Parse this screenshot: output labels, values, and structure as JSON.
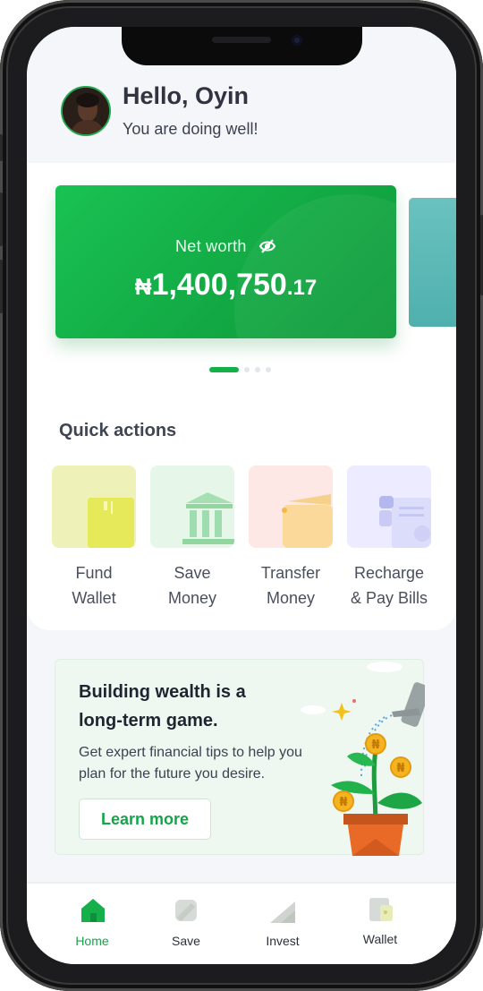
{
  "header": {
    "greeting": "Hello, Oyin",
    "subtitle": "You are doing well!"
  },
  "networth": {
    "label": "Net worth",
    "currency": "₦",
    "amount": "1,400,750",
    "cents": ".17",
    "visibility_icon": "eye-off-icon"
  },
  "carousel": {
    "pages": 4,
    "active": 1
  },
  "quick_actions": {
    "title": "Quick actions",
    "items": [
      {
        "label_line1": "Fund",
        "label_line2": "Wallet",
        "icon": "card-icon",
        "color": "#eef2b8"
      },
      {
        "label_line1": "Save",
        "label_line2": "Money",
        "icon": "bank-icon",
        "color": "#e6f7ea"
      },
      {
        "label_line1": "Transfer",
        "label_line2": "Money",
        "icon": "wallet-icon",
        "color": "#fde8e6"
      },
      {
        "label_line1": "Recharge",
        "label_line2": "& Pay Bills",
        "icon": "bill-icon",
        "color": "#ecebff"
      }
    ]
  },
  "promo": {
    "title": "Building wealth is a long-term game.",
    "body": "Get expert financial tips to help you plan for the future you desire.",
    "button": "Learn more",
    "coin_symbol": "₦"
  },
  "tabbar": {
    "items": [
      {
        "label": "Home",
        "icon": "home-icon",
        "active": true
      },
      {
        "label": "Save",
        "icon": "save-icon",
        "active": false
      },
      {
        "label": "Invest",
        "icon": "invest-icon",
        "active": false
      },
      {
        "label": "Wallet",
        "icon": "wallet-icon",
        "active": false
      }
    ]
  },
  "colors": {
    "brand": "#16b04b",
    "text_dark": "#2f3440",
    "screen_bg": "#f5f6f9"
  }
}
